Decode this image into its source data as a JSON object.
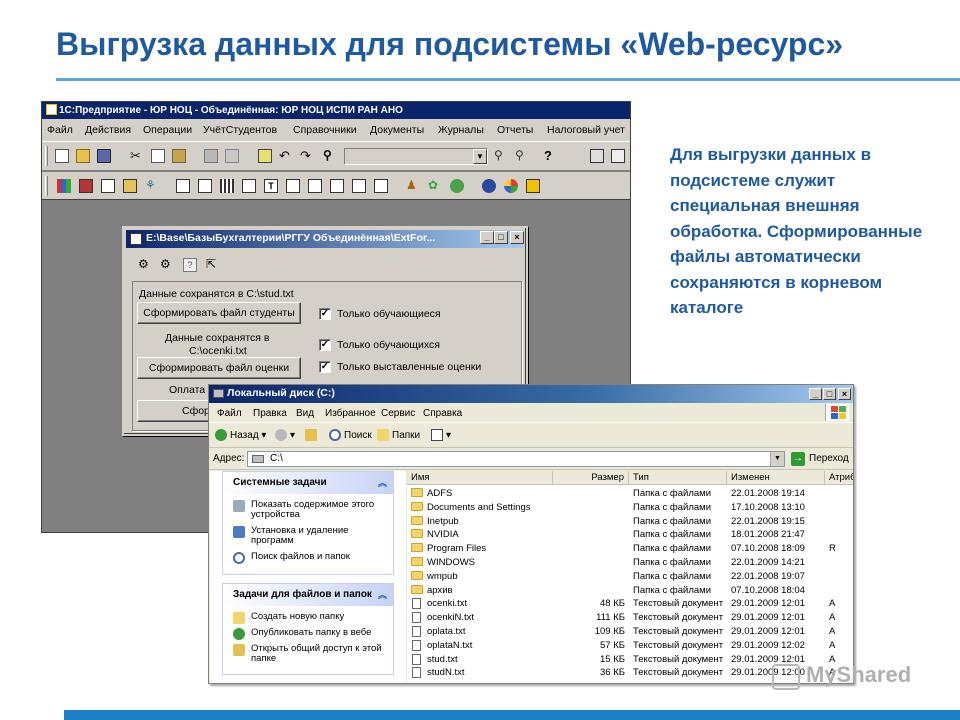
{
  "slide": {
    "title": "Выгрузка данных для подсистемы «Web-ресурс»",
    "description": "Для выгрузки данных в подсистеме служит специальная внешняя обработка. Сформированные файлы автоматически сохраняются в корневом каталоге",
    "watermark": "MyShared"
  },
  "onec": {
    "title": "1С:Предприятие - ЮР НОЦ - Объединённая: ЮР НОЦ ИСПИ РАН АНО",
    "menu": [
      "Файл",
      "Действия",
      "Операции",
      "УчётСтудентов",
      "Справочники",
      "Документы",
      "Журналы",
      "Отчеты",
      "Налоговый учет"
    ]
  },
  "dialog": {
    "title": "E:\\Base\\БазыБухгалтерии\\РГГУ Объединённая\\ExtFor...",
    "label_stud": "Данные сохранятся в C:\\stud.txt",
    "btn_students": "Сформировать файл студенты",
    "chk_students_only": "Только обучающиеся",
    "label_ocenki_1": "Данные сохранятся в",
    "label_ocenki_2": "C:\\ocenki.txt",
    "chk_ocenki_only": "Только обучающихся",
    "btn_ocenki": "Сформировать файл оценки",
    "chk_only_grades": "Только выставленные оценки",
    "label_oplata": "Оплата",
    "btn_partial": "Сфор"
  },
  "explorer": {
    "title": "Локальный диск (C:)",
    "menu": [
      "Файл",
      "Правка",
      "Вид",
      "Избранное",
      "Сервис",
      "Справка"
    ],
    "toolbar": {
      "back": "Назад",
      "search": "Поиск",
      "folders": "Папки"
    },
    "address_label": "Адрес:",
    "address_value": "C:\\",
    "go_label": "Переход",
    "system_tasks": {
      "header": "Системные задачи",
      "items": [
        "Показать содержимое этого устройства",
        "Установка и удаление программ",
        "Поиск файлов и папок"
      ]
    },
    "file_tasks": {
      "header": "Задачи для файлов и папок",
      "items": [
        "Создать новую папку",
        "Опубликовать папку в вебе",
        "Открыть общий доступ к этой папке"
      ]
    },
    "columns": [
      "Имя",
      "Размер",
      "Тип",
      "Изменен",
      "Атриб"
    ],
    "files": [
      {
        "name": "ADFS",
        "size": "",
        "type": "Папка с файлами",
        "modified": "22.01.2008 19:14",
        "attr": "",
        "kind": "folder"
      },
      {
        "name": "Documents and Settings",
        "size": "",
        "type": "Папка с файлами",
        "modified": "17.10.2008 13:10",
        "attr": "",
        "kind": "folder"
      },
      {
        "name": "Inetpub",
        "size": "",
        "type": "Папка с файлами",
        "modified": "22.01.2008 19:15",
        "attr": "",
        "kind": "folder"
      },
      {
        "name": "NVIDIA",
        "size": "",
        "type": "Папка с файлами",
        "modified": "18.01.2008 21:47",
        "attr": "",
        "kind": "folder"
      },
      {
        "name": "Program Files",
        "size": "",
        "type": "Папка с файлами",
        "modified": "07.10.2008 18:09",
        "attr": "R",
        "kind": "folder"
      },
      {
        "name": "WINDOWS",
        "size": "",
        "type": "Папка с файлами",
        "modified": "22.01.2009 14:21",
        "attr": "",
        "kind": "folder"
      },
      {
        "name": "wmpub",
        "size": "",
        "type": "Папка с файлами",
        "modified": "22.01.2008 19:07",
        "attr": "",
        "kind": "folder"
      },
      {
        "name": "архив",
        "size": "",
        "type": "Папка с файлами",
        "modified": "07.10.2008 18:04",
        "attr": "",
        "kind": "folder"
      },
      {
        "name": "ocenki.txt",
        "size": "48 КБ",
        "type": "Текстовый документ",
        "modified": "29.01.2009 12:01",
        "attr": "A",
        "kind": "file"
      },
      {
        "name": "ocenkiN.txt",
        "size": "111 КБ",
        "type": "Текстовый документ",
        "modified": "29.01.2009 12:01",
        "attr": "A",
        "kind": "file"
      },
      {
        "name": "oplata.txt",
        "size": "109 КБ",
        "type": "Текстовый документ",
        "modified": "29.01.2009 12:01",
        "attr": "A",
        "kind": "file"
      },
      {
        "name": "oplataN.txt",
        "size": "57 КБ",
        "type": "Текстовый документ",
        "modified": "29.01.2009 12:02",
        "attr": "A",
        "kind": "file"
      },
      {
        "name": "stud.txt",
        "size": "15 КБ",
        "type": "Текстовый документ",
        "modified": "29.01.2009 12:01",
        "attr": "A",
        "kind": "file"
      },
      {
        "name": "studN.txt",
        "size": "36 КБ",
        "type": "Текстовый документ",
        "modified": "29.01.2009 12:00",
        "attr": "A",
        "kind": "file"
      }
    ]
  },
  "colors": {
    "title_blue": "#1f5aa0",
    "accent_blue": "#1a7fc4",
    "classic_face": "#d4d0c8",
    "xp_face": "#ece9d8"
  }
}
